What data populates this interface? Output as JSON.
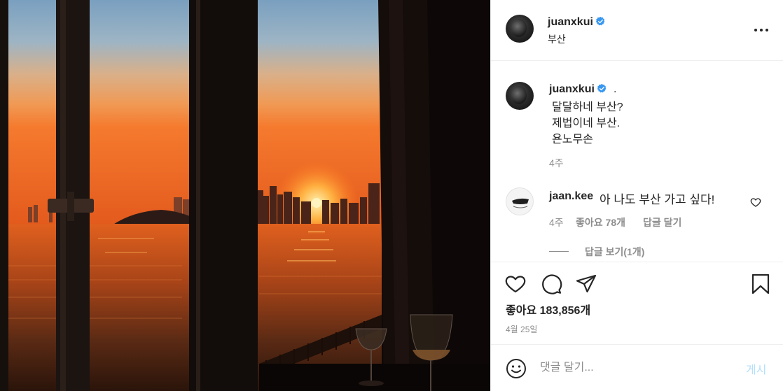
{
  "post": {
    "username": "juanxkui",
    "verified": true,
    "location": "부산",
    "more_icon": "more-horizontal-icon"
  },
  "caption": {
    "username": "juanxkui",
    "dot": ".",
    "lines": [
      "달달하네 부산?",
      "제법이네 부산.",
      "욘노무손"
    ],
    "time": "4주"
  },
  "comments": [
    {
      "username": "jaan.kee",
      "text": "아 나도 부산 가고 싶다!",
      "time": "4주",
      "likes": "좋아요 78개",
      "reply_label": "답글 달기",
      "view_replies": "답글 보기(1개)"
    }
  ],
  "actions": {
    "like_icon": "heart-icon",
    "comment_icon": "comment-icon",
    "share_icon": "send-icon",
    "save_icon": "bookmark-icon"
  },
  "likes_text": "좋아요 183,856개",
  "date": "4월 25일",
  "add_comment": {
    "placeholder": "댓글 달기...",
    "post_label": "게시",
    "post_color": "#b2dffc",
    "emoji_icon": "smiley-icon"
  },
  "colors": {
    "verified_blue": "#3897f0",
    "muted_text": "#8e8e8e",
    "primary_text": "#262626"
  }
}
